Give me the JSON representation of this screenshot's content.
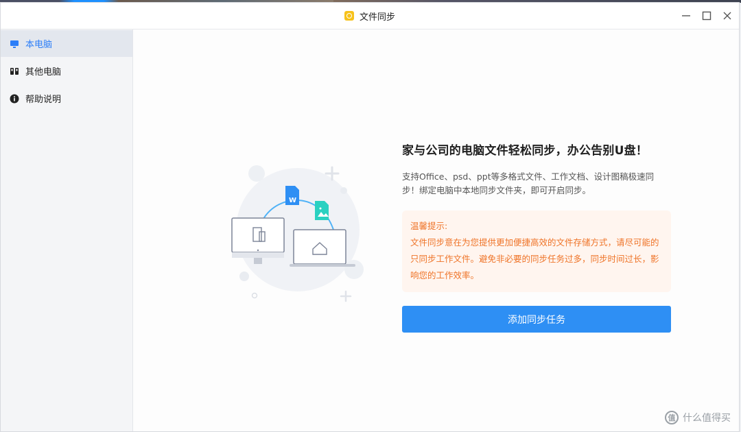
{
  "window": {
    "title": "文件同步",
    "icon": "sync-app-icon",
    "controls": [
      "minimize-icon",
      "maximize-icon",
      "close-icon"
    ]
  },
  "sidebar": {
    "items": [
      {
        "label": "本电脑",
        "icon": "monitor-icon",
        "active": true
      },
      {
        "label": "其他电脑",
        "icon": "devices-icon",
        "active": false
      },
      {
        "label": "帮助说明",
        "icon": "info-icon",
        "active": false
      }
    ]
  },
  "main": {
    "headline": "家与公司的电脑文件轻松同步，办公告别U盘！",
    "description": "支持Office、psd、ppt等多格式文件、工作文档、设计图稿极速同步！绑定电脑中本地同步文件夹，即可开启同步。",
    "tip": {
      "title": "温馨提示:",
      "text": "文件同步意在为您提供更加便捷高效的文件存储方式，请尽可能的只同步工作文件。避免非必要的同步任务过多，同步时间过长，影响您的工作效率。"
    },
    "button_label": "添加同步任务"
  },
  "watermark": {
    "text": "什么值得买",
    "logo_text": "值"
  },
  "colors": {
    "accent": "#2e8ff4",
    "active_text": "#2c7ef8",
    "tip_text": "#ef7428",
    "tip_bg": "#fff5ef"
  }
}
